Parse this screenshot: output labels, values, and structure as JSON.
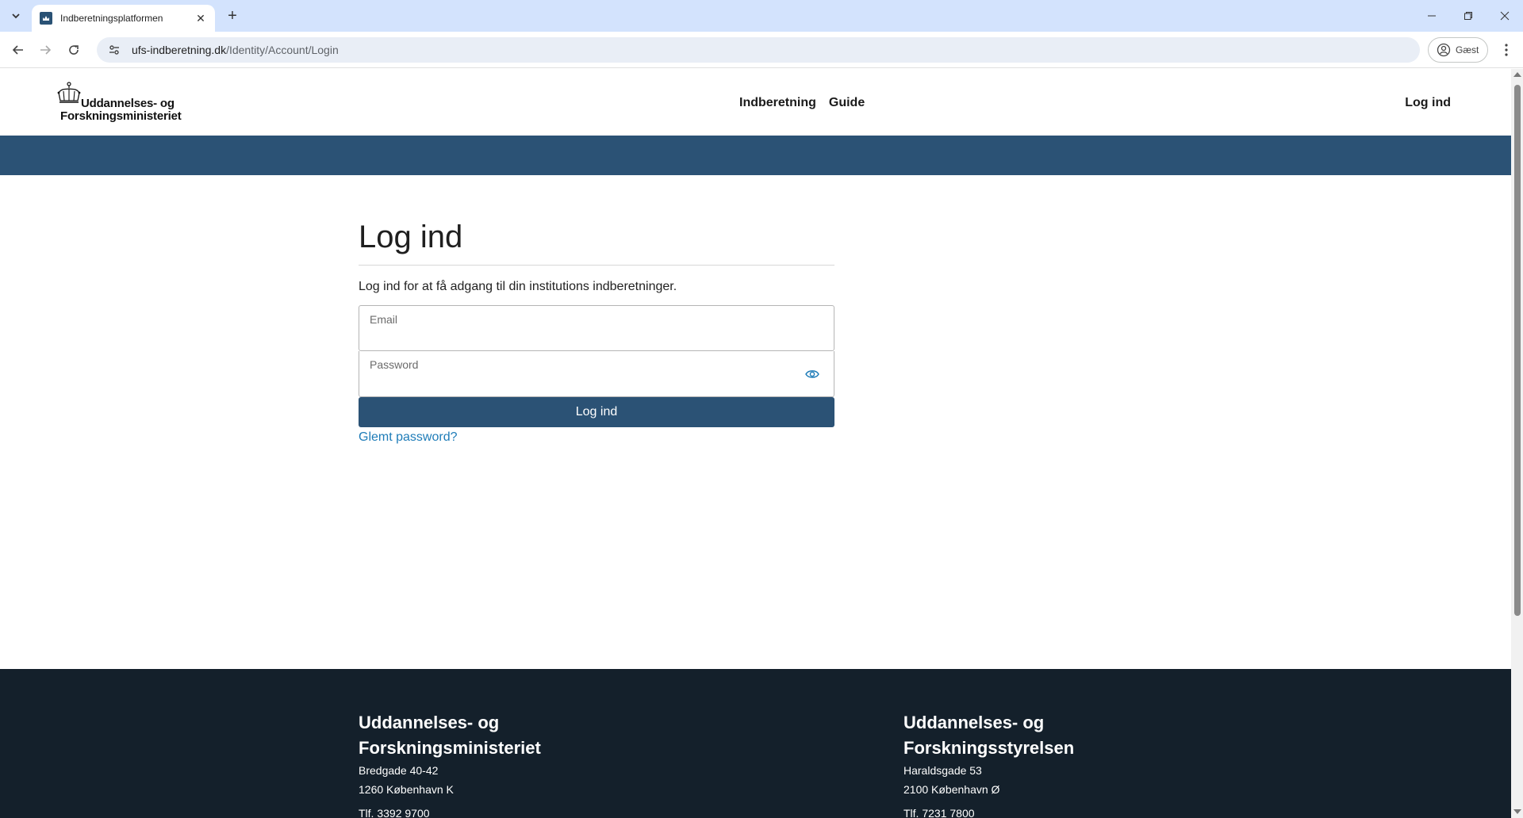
{
  "browser": {
    "tab_title": "Indberetningsplatformen",
    "url_host": "ufs-indberetning.dk",
    "url_path": "/Identity/Account/Login",
    "profile_label": "Gæst"
  },
  "header": {
    "logo_line1": "Uddannelses- og",
    "logo_line2": "Forskningsministeriet",
    "nav": [
      "Indberetning",
      "Guide"
    ],
    "login_link": "Log ind"
  },
  "login": {
    "title": "Log ind",
    "intro": "Log ind for at få adgang til din institutions indberetninger.",
    "email_label": "Email",
    "password_label": "Password",
    "submit_label": "Log ind",
    "forgot_label": "Glemt password?"
  },
  "footer": {
    "col1": {
      "line1": "Uddannelses- og",
      "line2": "Forskningsministeriet",
      "street": "Bredgade 40-42",
      "city": "1260 København K",
      "phone": "Tlf. 3392 9700"
    },
    "col2": {
      "line1": "Uddannelses- og",
      "line2": "Forskningsstyrelsen",
      "street": "Haraldsgade 53",
      "city": "2100 København Ø",
      "phone": "Tlf. 7231 7800"
    }
  },
  "colors": {
    "brand_blue": "#2b5275",
    "footer_bg": "#14202b",
    "link": "#1e7cb8"
  }
}
